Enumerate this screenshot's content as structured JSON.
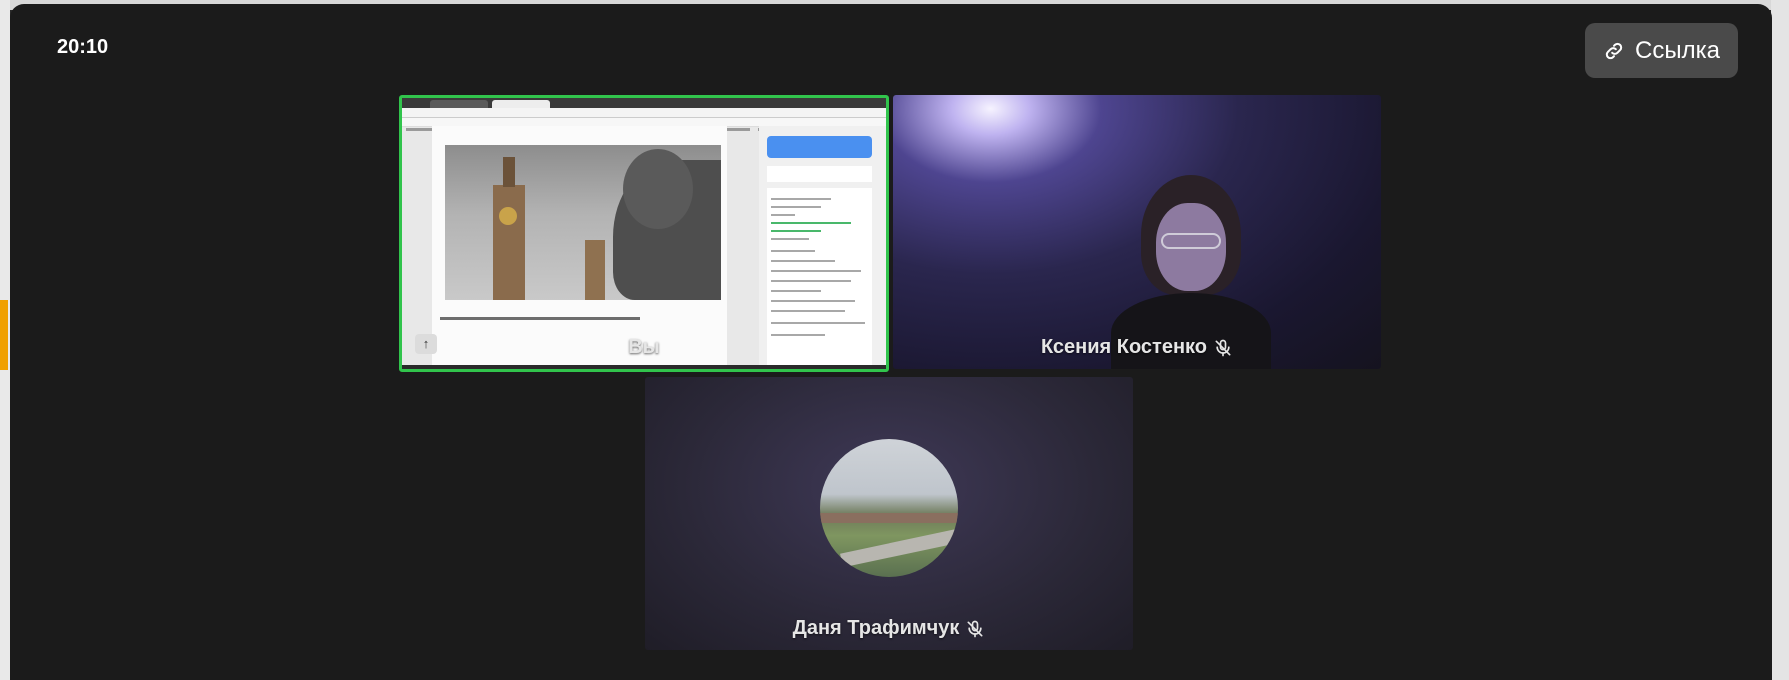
{
  "header": {
    "clock": "20:10",
    "link_button_label": "Ссылка"
  },
  "participants": [
    {
      "name": "Вы",
      "muted": false,
      "screen_sharing": true,
      "active_speaker": true
    },
    {
      "name": "Ксения Костенко",
      "muted": true,
      "screen_sharing": false
    },
    {
      "name": "Даня Трафимчук",
      "muted": true,
      "screen_sharing": false
    }
  ],
  "icons": {
    "link": "link-icon",
    "mic_off": "mic-off-icon",
    "share": "upload-icon"
  },
  "colors": {
    "active_speaker_border": "#31c44c",
    "modal_background": "#1b1b1b",
    "link_button_background": "#4a4a4a"
  }
}
